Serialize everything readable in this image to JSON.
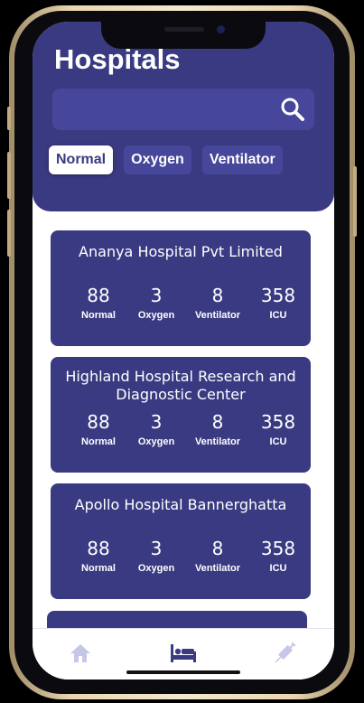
{
  "header": {
    "title": "Hospitals"
  },
  "search": {
    "placeholder": "",
    "value": ""
  },
  "filters": {
    "tabs": [
      {
        "label": "Normal",
        "active": true
      },
      {
        "label": "Oxygen",
        "active": false
      },
      {
        "label": "Ventilator",
        "active": false
      }
    ]
  },
  "hospitals": [
    {
      "name": "Ananya Hospital Pvt Limited",
      "stats": [
        {
          "value": "88",
          "label": "Normal"
        },
        {
          "value": "3",
          "label": "Oxygen"
        },
        {
          "value": "8",
          "label": "Ventilator"
        },
        {
          "value": "358",
          "label": "ICU"
        }
      ]
    },
    {
      "name": "Highland Hospital Research and Diagnostic Center",
      "stats": [
        {
          "value": "88",
          "label": "Normal"
        },
        {
          "value": "3",
          "label": "Oxygen"
        },
        {
          "value": "8",
          "label": "Ventilator"
        },
        {
          "value": "358",
          "label": "ICU"
        }
      ]
    },
    {
      "name": "Apollo Hospital Bannerghatta",
      "stats": [
        {
          "value": "88",
          "label": "Normal"
        },
        {
          "value": "3",
          "label": "Oxygen"
        },
        {
          "value": "8",
          "label": "Ventilator"
        },
        {
          "value": "358",
          "label": "ICU"
        }
      ]
    }
  ],
  "nav": {
    "items": [
      {
        "icon": "home-icon",
        "active": false
      },
      {
        "icon": "bed-icon",
        "active": true
      },
      {
        "icon": "syringe-icon",
        "active": false
      }
    ]
  },
  "colors": {
    "primary": "#3a3a82",
    "surface": "#46469a",
    "inactive_icon": "#c6c6e6",
    "background": "#ffffff"
  }
}
